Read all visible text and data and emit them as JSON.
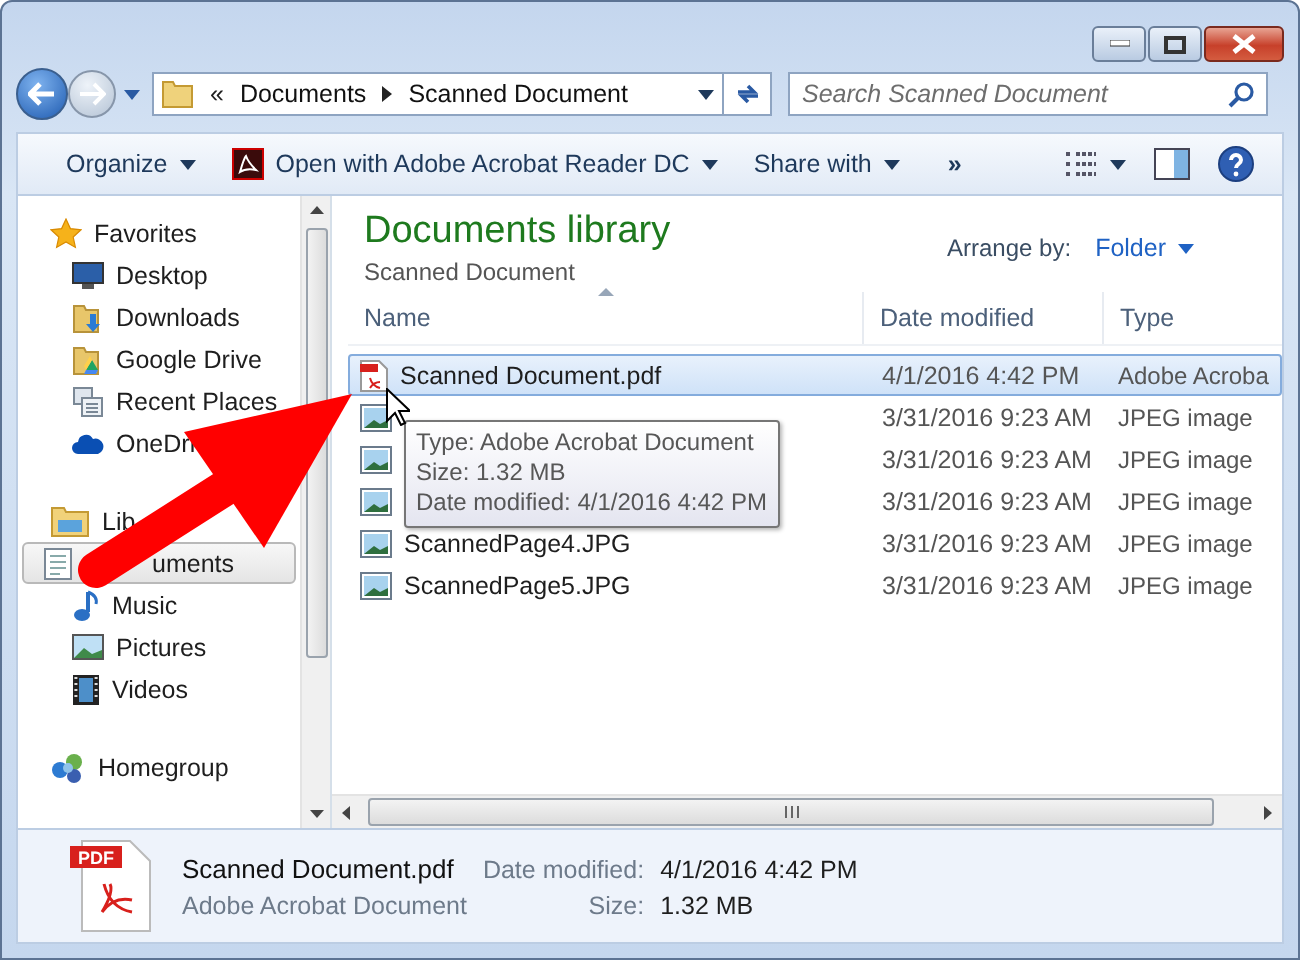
{
  "address_bar": {
    "overflow": "«",
    "crumbs": [
      "Documents",
      "Scanned Document"
    ]
  },
  "search": {
    "placeholder": "Search Scanned Document"
  },
  "toolbar": [
    {
      "label": "Organize",
      "kind": "menu"
    },
    {
      "label": "Open with Adobe Acrobat Reader DC",
      "kind": "app"
    },
    {
      "label": "Share with",
      "kind": "menu"
    },
    {
      "label": "»",
      "kind": "more"
    }
  ],
  "nav": [
    {
      "label": "Favorites",
      "kind": "favorites",
      "selected": false,
      "children": [
        {
          "label": "Desktop",
          "kind": "desktop",
          "selected": false
        },
        {
          "label": "Downloads",
          "kind": "downloads",
          "selected": false
        },
        {
          "label": "Google Drive",
          "kind": "gdrive",
          "selected": false
        },
        {
          "label": "Recent Places",
          "kind": "recent",
          "selected": false
        },
        {
          "label": "OneDri",
          "kind": "cloud",
          "selected": false
        }
      ]
    },
    {
      "label": "Lib",
      "kind": "libraries",
      "selected": false,
      "children": [
        {
          "label": "uments",
          "kind": "documents",
          "selected": true
        },
        {
          "label": "Music",
          "kind": "music",
          "selected": false
        },
        {
          "label": "Pictures",
          "kind": "pictures",
          "selected": false
        },
        {
          "label": "Videos",
          "kind": "videos",
          "selected": false
        }
      ]
    },
    {
      "label": "Homegroup",
      "kind": "homegroup",
      "selected": false
    }
  ],
  "library": {
    "title": "Documents library",
    "subtitle": "Scanned Document",
    "arrange_label": "Arrange by:",
    "arrange_value": "Folder"
  },
  "columns": [
    {
      "label": "Name",
      "sorted": true
    },
    {
      "label": "Date modified",
      "sorted": false
    },
    {
      "label": "Type",
      "sorted": false
    }
  ],
  "rows": [
    {
      "name": "Scanned Document.pdf",
      "date": "4/1/2016 4:42 PM",
      "type": "Adobe Acroba",
      "kind": "pdf",
      "selected": true
    },
    {
      "date": "3/31/2016 9:23 AM",
      "type": "JPEG image",
      "kind": "image",
      "selected": false
    },
    {
      "date": "3/31/2016 9:23 AM",
      "type": "JPEG image",
      "kind": "image",
      "selected": false
    },
    {
      "date": "3/31/2016 9:23 AM",
      "type": "JPEG image",
      "kind": "image",
      "selected": false
    },
    {
      "name": "ScannedPage4.JPG",
      "date": "3/31/2016 9:23 AM",
      "type": "JPEG image",
      "kind": "image",
      "selected": false
    },
    {
      "name": "ScannedPage5.JPG",
      "date": "3/31/2016 9:23 AM",
      "type": "JPEG image",
      "kind": "image",
      "selected": false
    }
  ],
  "tooltip": {
    "lines": [
      "Type: Adobe Acrobat Document",
      "Size: 1.32 MB",
      "Date modified: 4/1/2016 4:42 PM"
    ]
  },
  "details": {
    "icon_label": "PDF",
    "name": "Scanned Document.pdf",
    "type": "Adobe Acrobat Document",
    "fields": [
      {
        "label": "Date modified:",
        "value": "4/1/2016 4:42 PM"
      },
      {
        "label": "Size:",
        "value": "1.32 MB"
      }
    ]
  }
}
